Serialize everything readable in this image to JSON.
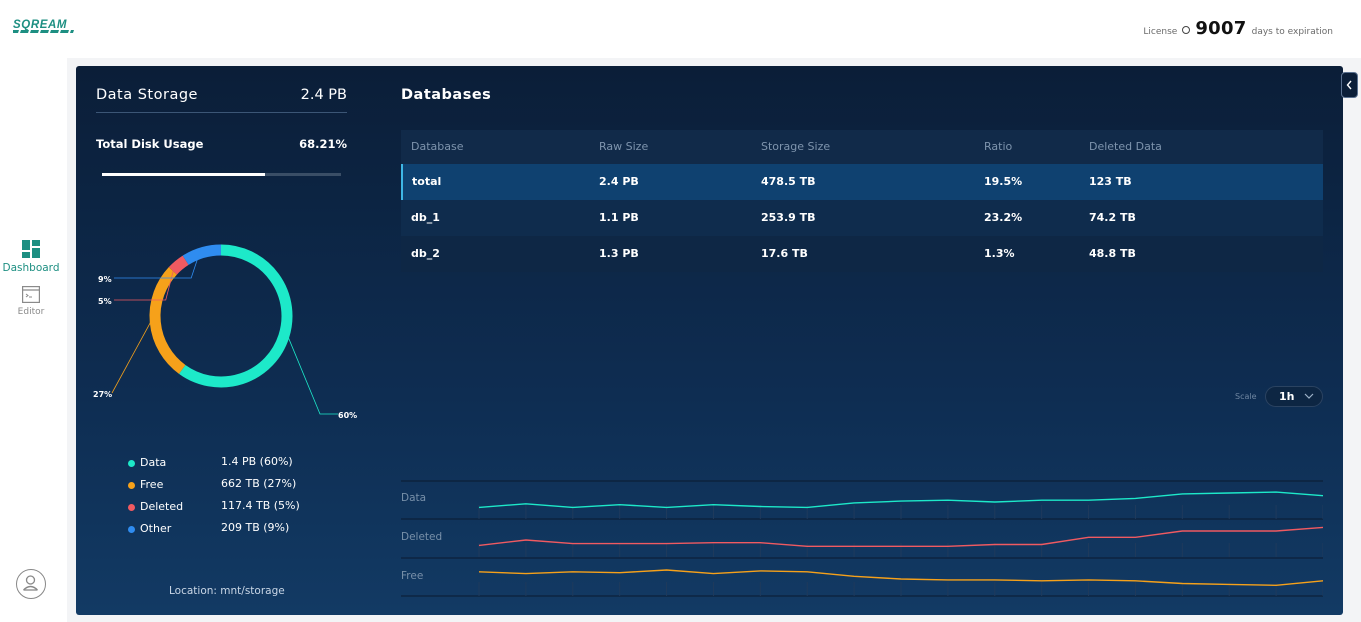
{
  "app": {
    "brand": "SQREAM"
  },
  "license": {
    "label": "License",
    "days": "9007",
    "suffix": "days to expiration"
  },
  "nav": {
    "dashboard": "Dashboard",
    "editor": "Editor"
  },
  "storage": {
    "title": "Data Storage",
    "total": "2.4 PB",
    "disk_label": "Total Disk Usage",
    "disk_pct": "68.21%",
    "disk_fraction": 0.6821,
    "location": "Location: mnt/storage"
  },
  "donut": {
    "segments": [
      {
        "name": "Data",
        "pct_label": "60%",
        "fraction": 0.6,
        "color": "#1de9c9"
      },
      {
        "name": "Free",
        "pct_label": "27%",
        "fraction": 0.27,
        "color": "#f6a11a"
      },
      {
        "name": "Deleted",
        "pct_label": "5%",
        "fraction": 0.04,
        "color": "#f05a61"
      },
      {
        "name": "Other",
        "pct_label": "9%",
        "fraction": 0.09,
        "color": "#2f8cf0"
      }
    ]
  },
  "legend": [
    {
      "name": "Data",
      "value": "1.4 PB (60%)",
      "color": "#1de9c9"
    },
    {
      "name": "Free",
      "value": "662 TB (27%)",
      "color": "#f6a11a"
    },
    {
      "name": "Deleted",
      "value": "117.4 TB (5%)",
      "color": "#f05a61"
    },
    {
      "name": "Other",
      "value": "209 TB (9%)",
      "color": "#2f8cf0"
    }
  ],
  "databases": {
    "title": "Databases",
    "columns": [
      "Database",
      "Raw Size",
      "Storage Size",
      "Ratio",
      "Deleted Data"
    ],
    "rows": [
      [
        "total",
        "2.4 PB",
        "478.5 TB",
        "19.5%",
        "123 TB"
      ],
      [
        "db_1",
        "1.1 PB",
        "253.9 TB",
        "23.2%",
        "74.2 TB"
      ],
      [
        "db_2",
        "1.3 PB",
        "17.6 TB",
        "1.3%",
        "48.8 TB"
      ]
    ]
  },
  "scale": {
    "label": "Scale",
    "value": "1h"
  },
  "trends": {
    "labels": [
      "Data",
      "Deleted",
      "Free"
    ],
    "colors": [
      "#1de9c9",
      "#f05a61",
      "#f6a11a"
    ],
    "series": [
      [
        4,
        8,
        4,
        7,
        4,
        7,
        5,
        4,
        9,
        11,
        12,
        10,
        12,
        12,
        14,
        19,
        20,
        21,
        17
      ],
      [
        4,
        10,
        6,
        6,
        6,
        7,
        7,
        3,
        3,
        3,
        3,
        5,
        5,
        13,
        13,
        20,
        20,
        20,
        24
      ],
      [
        18,
        16,
        18,
        17,
        20,
        16,
        19,
        18,
        13,
        10,
        9,
        9,
        8,
        9,
        8,
        5,
        4,
        3,
        8
      ]
    ]
  }
}
